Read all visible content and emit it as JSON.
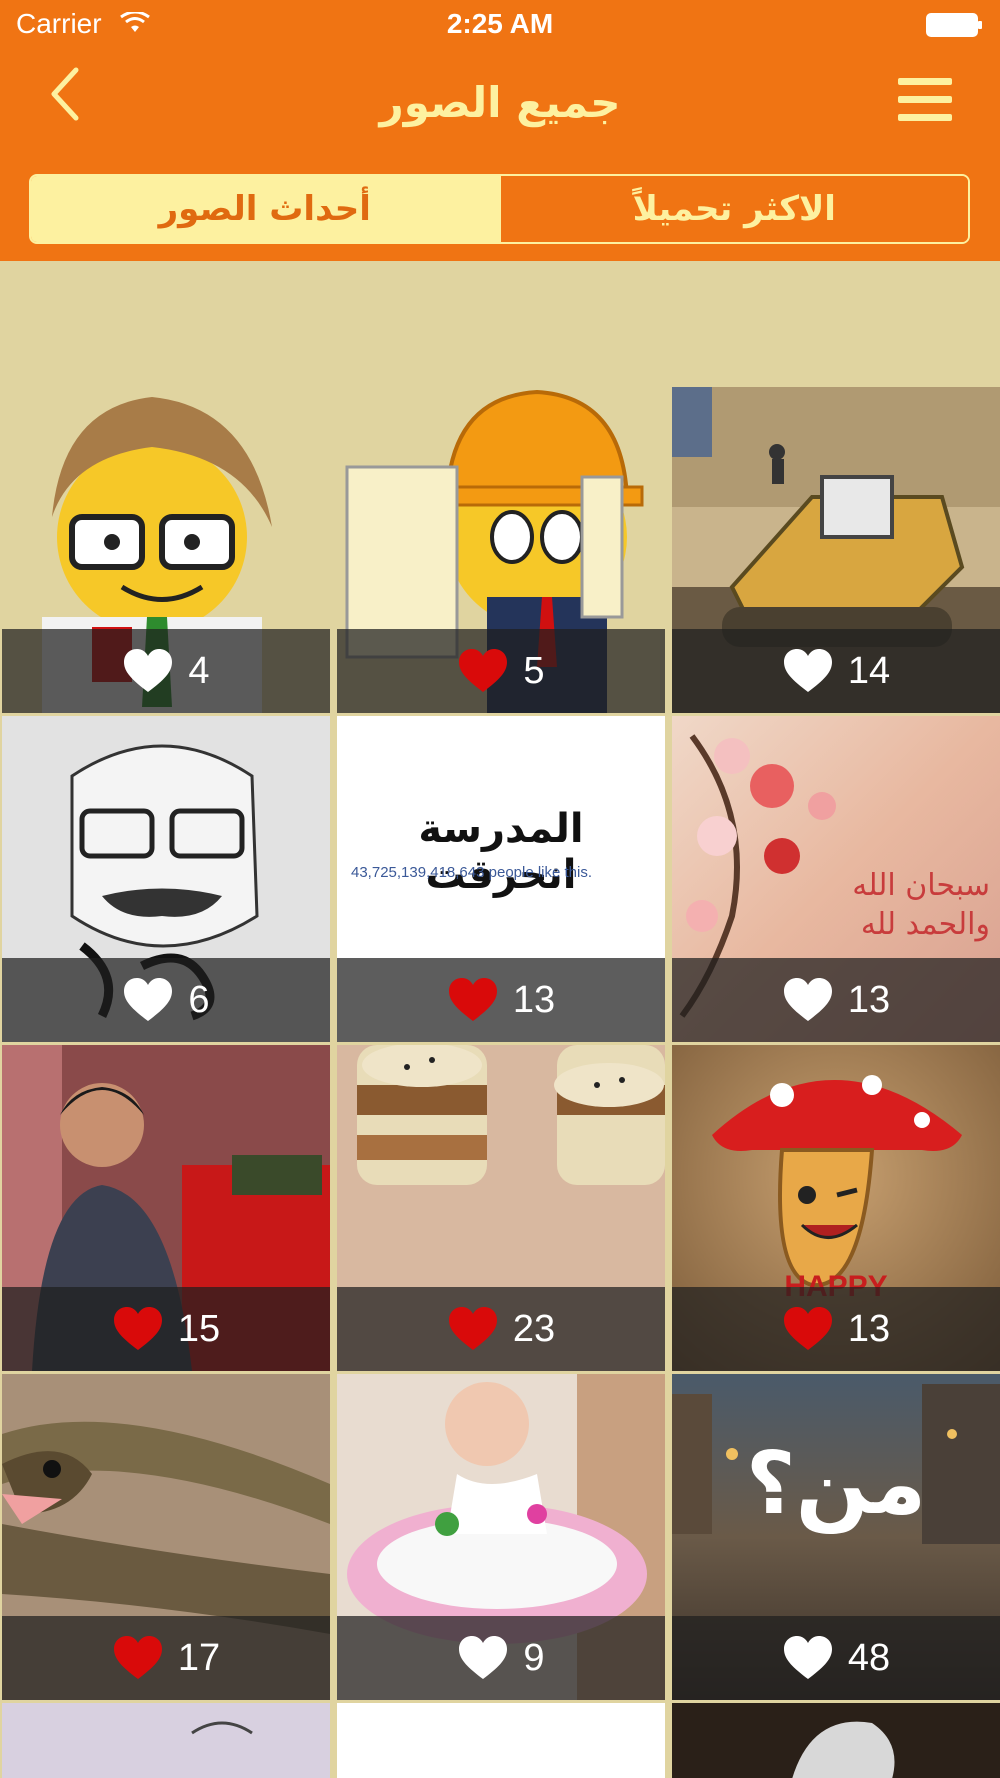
{
  "status_bar": {
    "carrier": "Carrier",
    "time": "2:25 AM"
  },
  "header": {
    "title": "جميع الصور",
    "tabs": [
      {
        "label": "أحداث الصور",
        "selected": true
      },
      {
        "label": "الاكثر تحميلاً",
        "selected": false
      }
    ]
  },
  "colors": {
    "accent": "#F07413",
    "highlight": "#FDF1A0",
    "background": "#E0D4A0",
    "liked_heart": "#D90A0A",
    "unliked_heart": "#FFFFFF"
  },
  "icons": {
    "back": "chevron-left-icon",
    "menu": "hamburger-menu-icon",
    "like": "heart-icon"
  },
  "photos": [
    {
      "likes": "4",
      "liked": false
    },
    {
      "likes": "5",
      "liked": true
    },
    {
      "likes": "14",
      "liked": false
    },
    {
      "likes": "6",
      "liked": false
    },
    {
      "likes": "13",
      "liked": true
    },
    {
      "likes": "13",
      "liked": false
    },
    {
      "likes": "15",
      "liked": true
    },
    {
      "likes": "23",
      "liked": true
    },
    {
      "likes": "13",
      "liked": true
    },
    {
      "likes": "17",
      "liked": true
    },
    {
      "likes": "9",
      "liked": false
    },
    {
      "likes": "48",
      "liked": false
    }
  ],
  "photo_captions": {
    "school": "المدرسة انحرقت",
    "school_likes_line": "43,725,139,418,643 people like this.",
    "flowers": "سبحان الله والحمد لله",
    "mushroom": "HAPPY",
    "question": "من؟"
  }
}
